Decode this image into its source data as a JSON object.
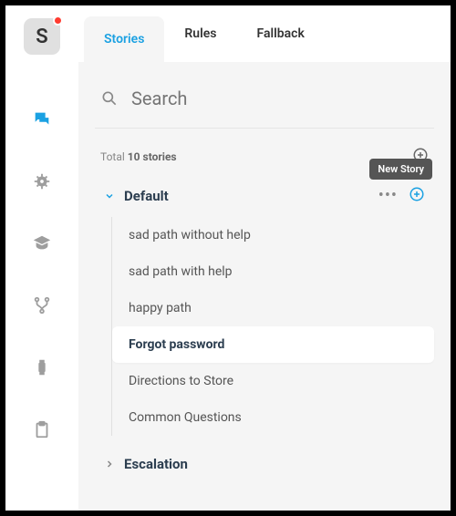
{
  "logo": "S",
  "tabs": {
    "stories": "Stories",
    "rules": "Rules",
    "fallback": "Fallback"
  },
  "search": {
    "placeholder": "Search"
  },
  "total": {
    "prefix": "Total ",
    "count": "10 stories"
  },
  "tooltip": {
    "new_story": "New Story"
  },
  "groups": {
    "default": {
      "title": "Default",
      "items": [
        "sad path without help",
        "sad path with help",
        "happy path",
        "Forgot password",
        "Directions to Store",
        "Common Questions"
      ],
      "selected_index": 3
    },
    "escalation": {
      "title": "Escalation"
    }
  }
}
